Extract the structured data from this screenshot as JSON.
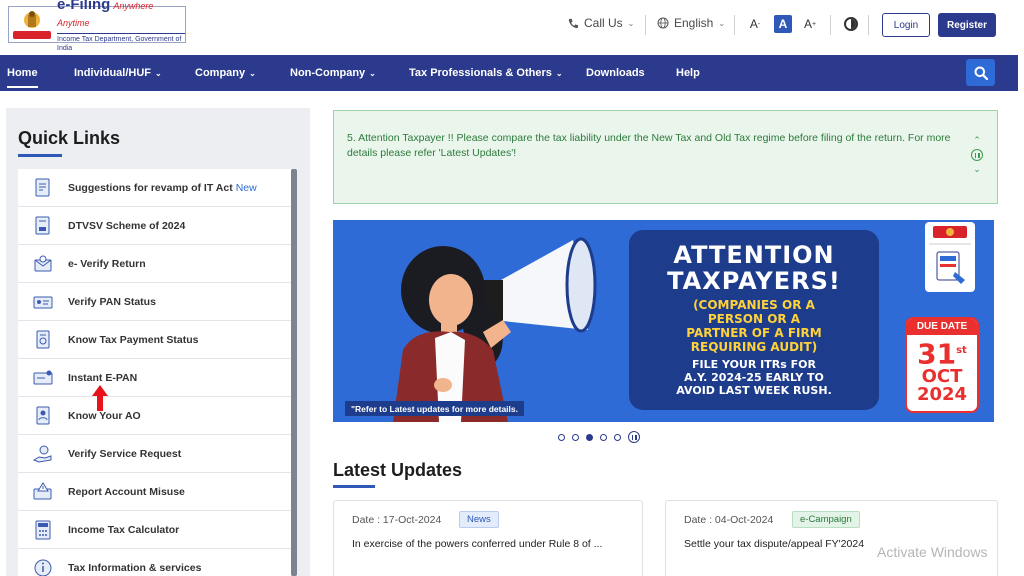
{
  "header": {
    "logo": {
      "brand": "e-Filing",
      "tagline": "Anywhere Anytime",
      "dept": "Income Tax Department, Government of India"
    },
    "call_us": "Call Us",
    "language": "English",
    "font_smaller": "A",
    "font_normal": "A",
    "font_larger": "A",
    "login": "Login",
    "register": "Register"
  },
  "nav": {
    "items": [
      {
        "label": "Home",
        "active": true
      },
      {
        "label": "Individual/HUF",
        "has_menu": true
      },
      {
        "label": "Company",
        "has_menu": true
      },
      {
        "label": "Non-Company",
        "has_menu": true
      },
      {
        "label": "Tax Professionals & Others",
        "has_menu": true
      },
      {
        "label": "Downloads"
      },
      {
        "label": "Help"
      }
    ]
  },
  "quick_links": {
    "title": "Quick Links",
    "items": [
      {
        "label": "Suggestions for revamp of IT Act",
        "badge": "New",
        "icon": "document-edit-icon"
      },
      {
        "label": "DTVSV Scheme of 2024",
        "icon": "document-icon"
      },
      {
        "label": "e- Verify Return",
        "icon": "verify-envelope-icon"
      },
      {
        "label": "Verify PAN Status",
        "icon": "pan-card-icon"
      },
      {
        "label": "Know Tax Payment Status",
        "icon": "payment-doc-icon"
      },
      {
        "label": "Instant E-PAN",
        "icon": "id-card-icon"
      },
      {
        "label": "Know Your AO",
        "icon": "person-doc-icon"
      },
      {
        "label": "Verify Service Request",
        "icon": "service-hand-icon"
      },
      {
        "label": "Report Account Misuse",
        "icon": "warning-card-icon"
      },
      {
        "label": "Income Tax Calculator",
        "icon": "calculator-icon"
      },
      {
        "label": "Tax Information & services",
        "icon": "info-icon"
      }
    ]
  },
  "alert": {
    "text": "5. Attention Taxpayer !!  Please compare the tax liability under the New Tax and Old Tax regime before filing of the return. For more details please refer 'Latest Updates'!"
  },
  "banner": {
    "note": "\"Refer to Latest updates for more details.",
    "title_line1": "ATTENTION",
    "title_line2": "TAXPAYERS!",
    "sub_line1": "(COMPANIES OR A",
    "sub_line2": "PERSON OR A",
    "sub_line3": "PARTNER OF A FIRM",
    "sub_line4": "REQUIRING AUDIT)",
    "body_line1": "FILE YOUR ITRs FOR",
    "body_line2": "A.Y. 2024-25 EARLY TO",
    "body_line3": "AVOID LAST WEEK RUSH.",
    "due_label": "DUE DATE",
    "due_day": "31",
    "due_suffix": "st",
    "due_month": "OCT",
    "due_year": "2024",
    "slides": 5,
    "active_slide": 3
  },
  "latest_updates": {
    "title": "Latest Updates",
    "cards": [
      {
        "date": "Date : 17-Oct-2024",
        "tag": "News",
        "text": "In exercise of the powers conferred under Rule 8 of ..."
      },
      {
        "date": "Date : 04-Oct-2024",
        "tag": "e-Campaign",
        "text": "Settle your tax dispute/appeal FY'2024"
      }
    ]
  },
  "watermark": "Activate Windows",
  "colors": {
    "navy": "#2b3a8c",
    "accent_blue": "#2f6bd6",
    "alert_green": "#2d7a3c",
    "due_red": "#e9302f"
  }
}
